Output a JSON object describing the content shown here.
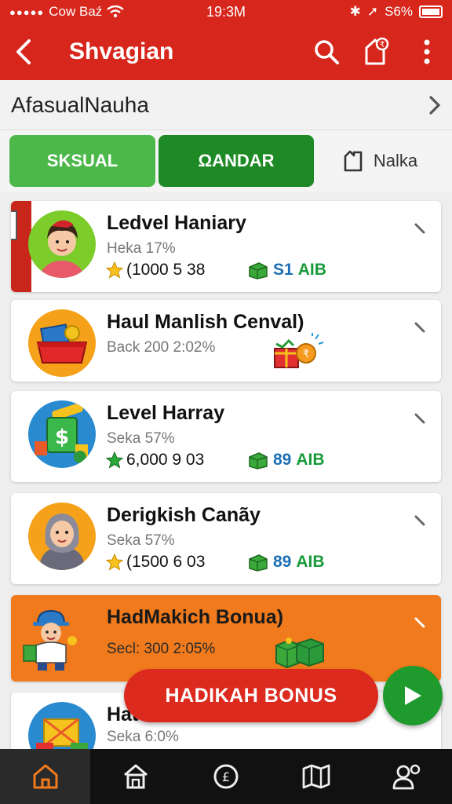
{
  "status": {
    "carrier": "Cow Βaź",
    "time": "19:3M",
    "battery": "S6%"
  },
  "appbar": {
    "title": "Shvagian"
  },
  "breadcrumb": {
    "text": "AfasualNauha"
  },
  "tabs": [
    {
      "label": "SKSUAL"
    },
    {
      "label": "ΩANDAR"
    },
    {
      "label": "Nalka"
    }
  ],
  "cards": [
    {
      "title": "Ledvel Haniary",
      "sub": "Heka 17%",
      "stars": "(1000 5 38",
      "reward_num": "S1",
      "reward_unit": "AIB"
    },
    {
      "title": "Haul Manlish Cenval)",
      "sub": "Back 200 2:02%"
    },
    {
      "title": "Level Harray",
      "sub": "Seka 57%",
      "stars": "6,000 9 03",
      "reward_num": "89",
      "reward_unit": "AIB"
    },
    {
      "title": "Derigkish Canãy",
      "sub": "Seka 57%",
      "stars": "(1500 6 03",
      "reward_num": "89",
      "reward_unit": "AIB"
    },
    {
      "title": "HadMakich Bonua)",
      "sub": "Secl: 300 2:05%"
    },
    {
      "title": "Hat",
      "sub": "Seka 6:0%"
    }
  ],
  "bonus_button": {
    "label": "HADIKAH BONUS"
  },
  "colors": {
    "primary": "#d7261c",
    "green": "#4cb84a",
    "dark_green": "#1e8a25",
    "orange": "#f07a1c"
  },
  "icons": [
    "back-arrow-icon",
    "search-icon",
    "rupee-bag-icon",
    "more-vert-icon",
    "chevron-right-icon",
    "bookmark-icon",
    "star-icon",
    "cash-icon",
    "gift-icon",
    "play-icon",
    "house-icon",
    "home-icon",
    "coin-icon",
    "map-icon",
    "profile-icon"
  ]
}
